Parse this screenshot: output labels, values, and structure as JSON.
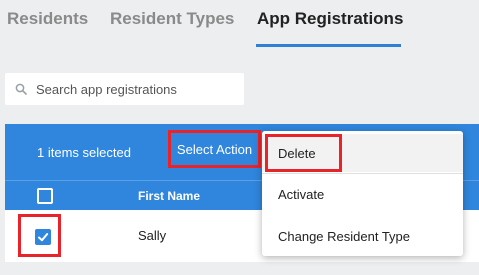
{
  "tabs": [
    {
      "label": "Residents"
    },
    {
      "label": "Resident Types"
    },
    {
      "label": "App Registrations"
    }
  ],
  "active_tab": "App Registrations",
  "search": {
    "placeholder": "Search app registrations",
    "icon": "search-icon"
  },
  "table": {
    "selected_count_text": "1 items selected",
    "select_action_label": "Select Action",
    "columns": [
      {
        "label": "First Name"
      }
    ],
    "rows": [
      {
        "first_name": "Sally",
        "checked": true
      }
    ],
    "header_checked": false
  },
  "menu": {
    "items": [
      {
        "label": "Delete"
      },
      {
        "label": "Activate"
      },
      {
        "label": "Change Resident Type"
      }
    ]
  },
  "colors": {
    "accent": "#2f86dc",
    "highlight_outline": "#e8232a",
    "background": "#eceef0"
  }
}
